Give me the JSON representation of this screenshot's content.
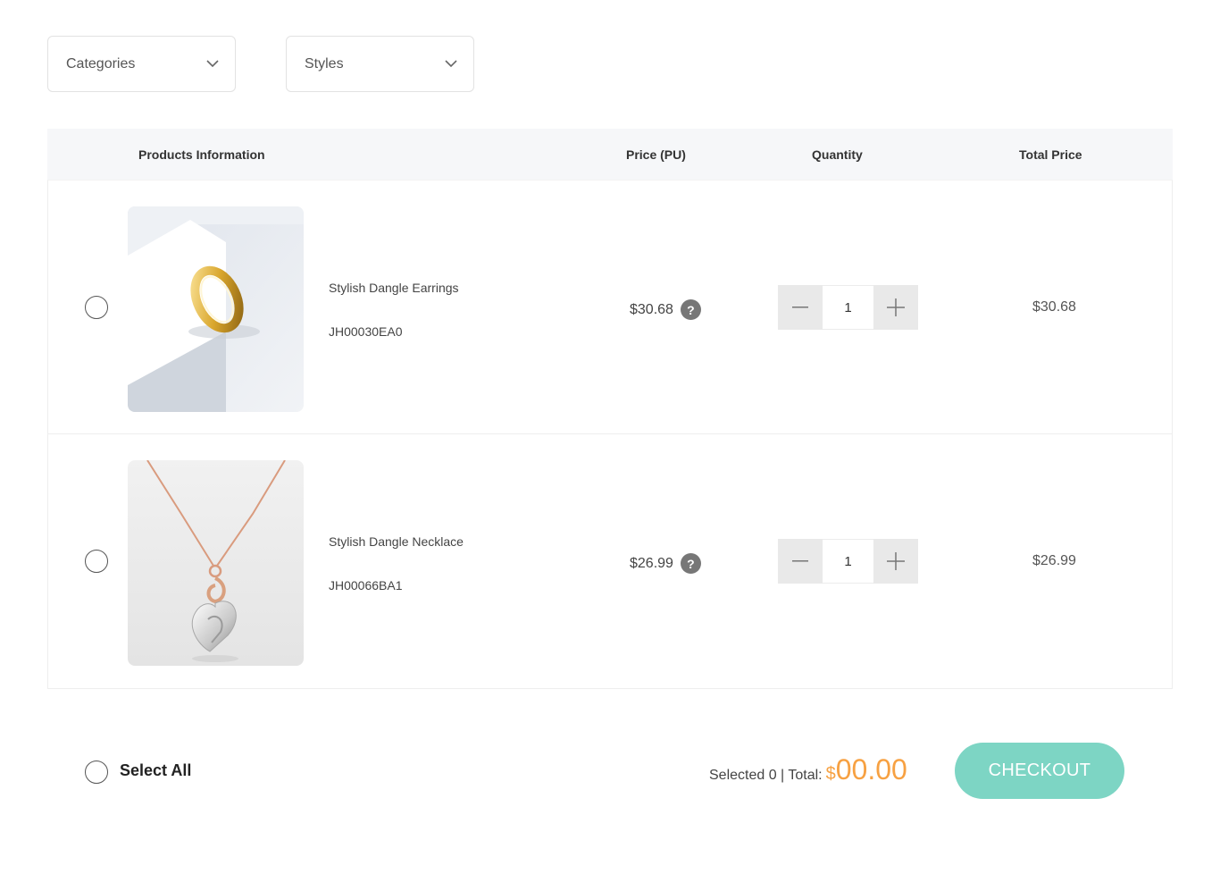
{
  "filters": {
    "categories_label": "Categories",
    "styles_label": "Styles"
  },
  "table": {
    "headers": {
      "product": "Products Information",
      "price": "Price (PU)",
      "quantity": "Quantity",
      "total": "Total Price"
    },
    "rows": [
      {
        "name": "Stylish Dangle Earrings",
        "sku": "JH00030EA0",
        "price": "$30.68",
        "quantity": "1",
        "total": "$30.68",
        "image_icon": "gold-ring-image"
      },
      {
        "name": "Stylish Dangle Necklace",
        "sku": "JH00066BA1",
        "price": "$26.99",
        "quantity": "1",
        "total": "$26.99",
        "image_icon": "heart-pendant-image"
      }
    ]
  },
  "help_glyph": "?",
  "footer": {
    "select_all": "Select All",
    "summary_label": "Selected 0 | Total:",
    "currency": "$",
    "amount": "00.00",
    "checkout": "CHECKOUT"
  },
  "colors": {
    "accent_orange": "#f7a142",
    "checkout_teal": "#7dd5c4",
    "header_bg": "#f6f7f9"
  }
}
